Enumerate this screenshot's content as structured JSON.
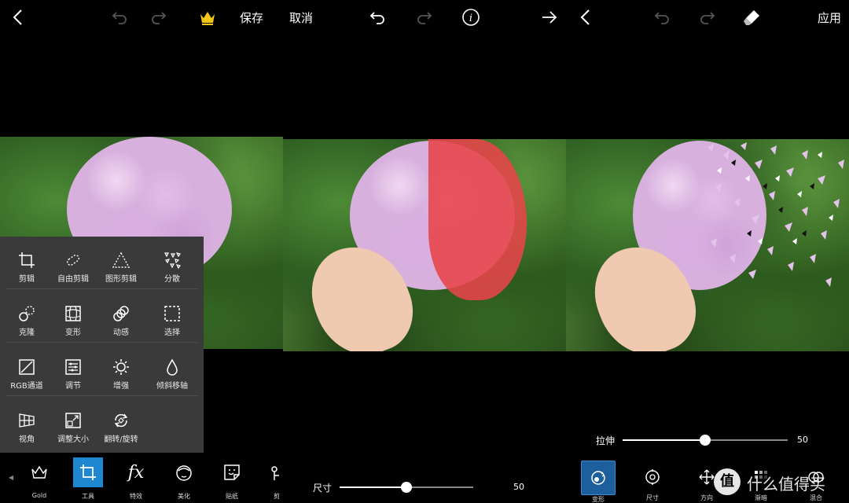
{
  "panel1": {
    "save_label": "保存",
    "tools": [
      {
        "label": "剪辑",
        "icon": "crop-icon"
      },
      {
        "label": "自由剪辑",
        "icon": "free-crop-icon"
      },
      {
        "label": "图形剪辑",
        "icon": "shape-crop-icon"
      },
      {
        "label": "分散",
        "icon": "dispersion-icon"
      },
      {
        "label": "克隆",
        "icon": "clone-icon"
      },
      {
        "label": "变形",
        "icon": "warp-icon"
      },
      {
        "label": "动感",
        "icon": "motion-icon"
      },
      {
        "label": "选择",
        "icon": "selection-icon"
      },
      {
        "label": "RGB通道",
        "icon": "curves-icon"
      },
      {
        "label": "调节",
        "icon": "adjust-icon"
      },
      {
        "label": "增强",
        "icon": "enhance-icon"
      },
      {
        "label": "倾斜移轴",
        "icon": "tilt-shift-icon"
      },
      {
        "label": "视角",
        "icon": "perspective-icon"
      },
      {
        "label": "调整大小",
        "icon": "resize-icon"
      },
      {
        "label": "翻转/旋转",
        "icon": "flip-rotate-icon"
      }
    ],
    "toolbar": [
      {
        "label": "Gold",
        "icon": "crown-icon"
      },
      {
        "label": "工具",
        "icon": "crop-icon"
      },
      {
        "label": "特效",
        "icon": "fx-icon"
      },
      {
        "label": "美化",
        "icon": "beautify-icon"
      },
      {
        "label": "贴纸",
        "icon": "sticker-icon"
      },
      {
        "label": "剪",
        "icon": "cutout-icon"
      }
    ]
  },
  "panel2": {
    "cancel_label": "取消",
    "slider_label": "尺寸",
    "slider_value": "50",
    "slider_fraction": 0.5
  },
  "panel3": {
    "apply_label": "应用",
    "slider_label": "拉伸",
    "slider_value": "50",
    "slider_fraction": 0.5,
    "toolbar": [
      {
        "label": "变形",
        "icon": "dispersion-warp-icon"
      },
      {
        "label": "尺寸",
        "icon": "size-icon"
      },
      {
        "label": "方向",
        "icon": "direction-icon"
      },
      {
        "label": "渐暗",
        "icon": "fade-icon"
      },
      {
        "label": "混合",
        "icon": "blend-icon"
      }
    ]
  },
  "watermark": {
    "badge": "值",
    "text": "什么值得买"
  },
  "colors": {
    "accent": "#1f86d1",
    "crown": "#f5c518",
    "selection_mask": "#e8444a"
  }
}
